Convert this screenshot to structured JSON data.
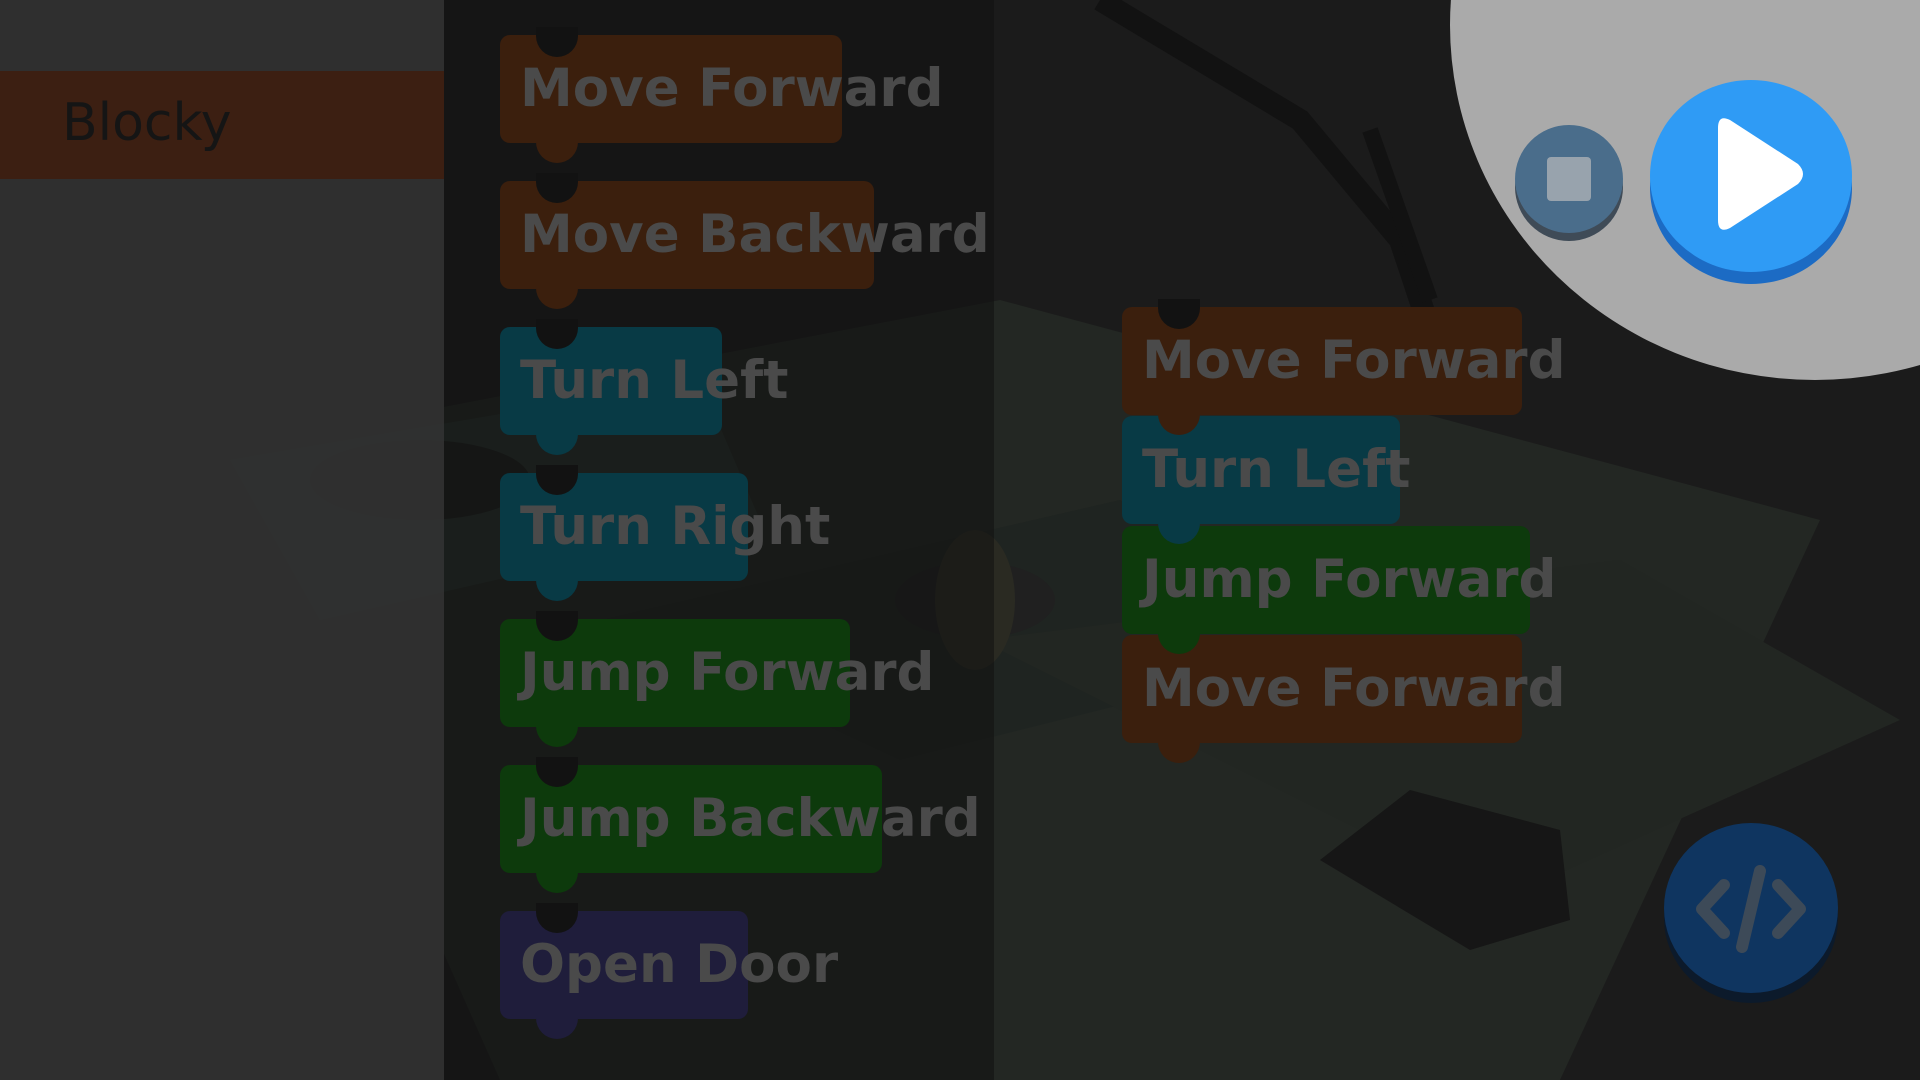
{
  "sidebar": {
    "categories": [
      {
        "label": "Blocky",
        "color": "#3c1f12"
      }
    ]
  },
  "flyout": {
    "blocks": [
      {
        "label": "Move Forward",
        "kind": "move"
      },
      {
        "label": "Move Backward",
        "kind": "move"
      },
      {
        "label": "Turn Left",
        "kind": "turn"
      },
      {
        "label": "Turn Right",
        "kind": "turn"
      },
      {
        "label": "Jump Forward",
        "kind": "jump"
      },
      {
        "label": "Jump Backward",
        "kind": "jump"
      },
      {
        "label": "Open Door",
        "kind": "door"
      }
    ]
  },
  "workspace": {
    "program": [
      {
        "label": "Move Forward",
        "kind": "move"
      },
      {
        "label": "Turn Left",
        "kind": "turn"
      },
      {
        "label": "Jump Forward",
        "kind": "jump"
      },
      {
        "label": "Move Forward",
        "kind": "move"
      }
    ]
  },
  "controls": {
    "stop_icon": "stop-icon",
    "play_icon": "play-icon",
    "code_icon": "code-icon"
  },
  "colors": {
    "move": "#3b1f0d",
    "turn": "#083a45",
    "jump": "#0d3a0c",
    "door": "#1f1d3b",
    "play": "#2f9bf5",
    "stop": "#4a6d8b",
    "code": "#0f3560"
  }
}
